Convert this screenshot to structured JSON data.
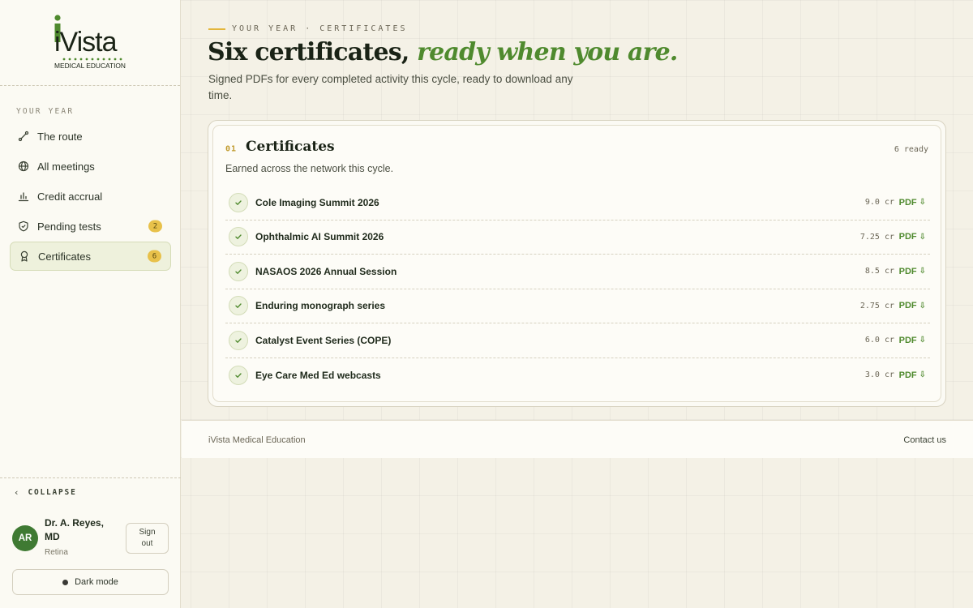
{
  "brand": {
    "logo_word": "iVista",
    "logo_tagline": "MEDICAL EDUCATION",
    "colors": {
      "accent_green": "#4f8a2e",
      "accent_gold": "#e3b63c",
      "badge": "#e8c14a"
    }
  },
  "sidebar": {
    "section_label": "YOUR YEAR",
    "items": [
      {
        "label": "The route",
        "icon": "route-icon",
        "badge": null,
        "active": false
      },
      {
        "label": "All meetings",
        "icon": "globe-icon",
        "badge": null,
        "active": false
      },
      {
        "label": "Credit accrual",
        "icon": "bar-chart-icon",
        "badge": null,
        "active": false
      },
      {
        "label": "Pending tests",
        "icon": "shield-icon",
        "badge": "2",
        "active": false
      },
      {
        "label": "Certificates",
        "icon": "award-icon",
        "badge": "6",
        "active": true
      }
    ],
    "collapse_label": "COLLAPSE",
    "user": {
      "initials": "AR",
      "name": "Dr. A. Reyes, MD",
      "specialty": "Retina"
    },
    "signout_label": "Sign out",
    "dark_mode_label": "Dark mode"
  },
  "header": {
    "eyebrow": "YOUR YEAR · CERTIFICATES",
    "headline_plain": "Six certificates, ",
    "headline_accent": "ready when you are.",
    "subline": "Signed PDFs for every completed activity this cycle, ready to download any time."
  },
  "card": {
    "number": "01",
    "title": "Certificates",
    "count": "6 ready",
    "subtitle": "Earned across the network this cycle.",
    "rows": [
      {
        "title": "Cole Imaging Summit 2026",
        "credits": "9.0 cr",
        "pdf": "PDF"
      },
      {
        "title": "Ophthalmic AI Summit 2026",
        "credits": "7.25 cr",
        "pdf": "PDF"
      },
      {
        "title": "NASAOS 2026 Annual Session",
        "credits": "8.5 cr",
        "pdf": "PDF"
      },
      {
        "title": "Enduring monograph series",
        "credits": "2.75 cr",
        "pdf": "PDF"
      },
      {
        "title": "Catalyst Event Series (COPE)",
        "credits": "6.0 cr",
        "pdf": "PDF"
      },
      {
        "title": "Eye Care Med Ed webcasts",
        "credits": "3.0 cr",
        "pdf": "PDF"
      }
    ]
  },
  "footer": {
    "left": "iVista Medical Education",
    "right": "Contact us"
  }
}
